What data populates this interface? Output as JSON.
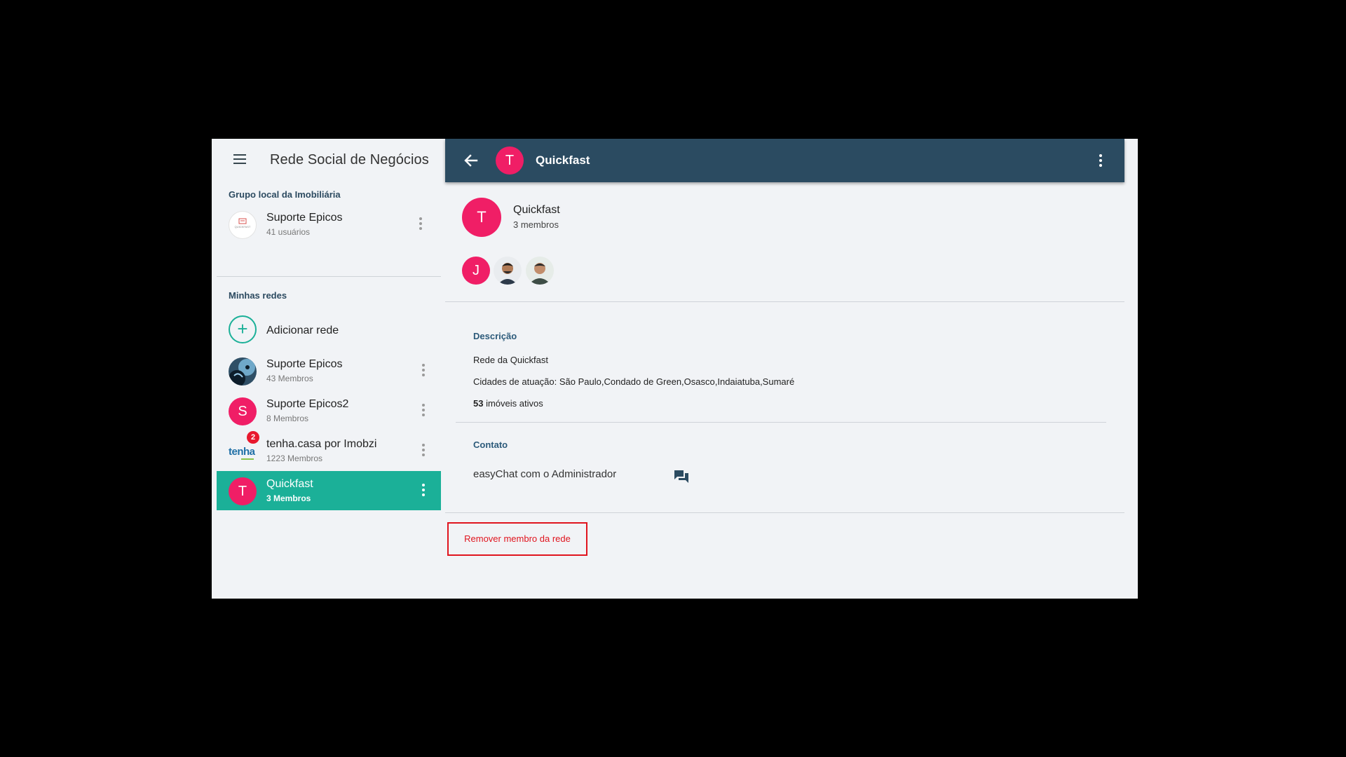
{
  "sidebar": {
    "title": "Rede Social de Negócios",
    "local_group": {
      "section_title": "Grupo local da Imobiliária",
      "item": {
        "name": "Suporte Epicos",
        "sub": "41 usuários",
        "logo_text": "QUICKFAST"
      }
    },
    "my_networks": {
      "section_title": "Minhas redes",
      "add_label": "Adicionar rede",
      "items": [
        {
          "name": "Suporte Epicos",
          "sub": "43 Membros"
        },
        {
          "name": "Suporte Epicos2",
          "sub": "8 Membros",
          "initial": "S"
        },
        {
          "name": "tenha.casa por Imobzi",
          "sub": "1223 Membros",
          "badge": "2",
          "logo_text": "tenha"
        },
        {
          "name": "Quickfast",
          "sub": "3 Membros",
          "initial": "T",
          "active": true
        }
      ]
    }
  },
  "topbar": {
    "initial": "T",
    "title": "Quickfast"
  },
  "network": {
    "initial": "T",
    "name": "Quickfast",
    "member_count": "3 membros",
    "members": [
      {
        "initial": "J"
      }
    ]
  },
  "description": {
    "label": "Descrição",
    "text": "Rede da Quickfast",
    "cities": "Cidades de atuação: São Paulo,Condado de Green,Osasco,Indaiatuba,Sumaré",
    "properties_count": "53",
    "properties_label": " imóveis ativos"
  },
  "contact": {
    "label": "Contato",
    "text": "easyChat com o Administrador"
  },
  "remove_button": "Remover membro da rede",
  "colors": {
    "accent": "#1bb098",
    "header": "#2b4b61",
    "avatar": "#f01e66",
    "danger": "#e0141e"
  }
}
